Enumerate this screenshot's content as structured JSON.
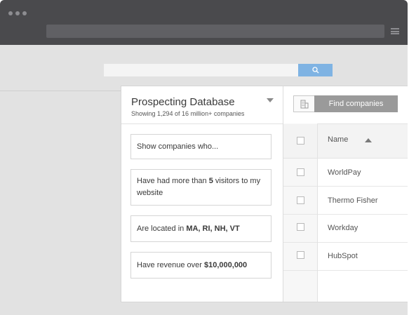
{
  "browser": {
    "url": ""
  },
  "search": {
    "value": "",
    "button_icon": "search-icon"
  },
  "panel": {
    "title": "Prospecting Database",
    "subtitle": "Showing 1,294 of 16 million+ companies",
    "criteria": {
      "intro": "Show companies who...",
      "visitors": {
        "pre": "Have had more than ",
        "bold": "5",
        "post": " visitors to my website"
      },
      "located": {
        "pre": "Are located in ",
        "bold": "MA, RI, NH, VT"
      },
      "revenue": {
        "pre": "Have revenue over ",
        "bold": "$10,000,000"
      }
    }
  },
  "results": {
    "find_button": "Find companies",
    "building_icon": "building-icon",
    "column_name": "Name",
    "rows": [
      {
        "name": "WorldPay"
      },
      {
        "name": "Thermo Fisher"
      },
      {
        "name": "Workday"
      },
      {
        "name": "HubSpot"
      }
    ]
  }
}
